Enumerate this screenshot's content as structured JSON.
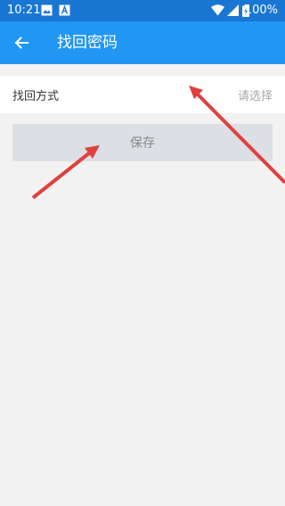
{
  "status_bar": {
    "time": "10:21",
    "battery_percent": "100%",
    "icons": [
      "image-icon",
      "font-icon",
      "wifi-icon",
      "signal-icon",
      "battery-icon"
    ]
  },
  "app_bar": {
    "title": "找回密码",
    "back_icon": "arrow-back-icon",
    "color": "#2196f3"
  },
  "form": {
    "recovery_method_label": "找回方式",
    "recovery_method_placeholder": "请选择"
  },
  "save_button": {
    "label": "保存"
  },
  "annotation_color": "#e04040"
}
